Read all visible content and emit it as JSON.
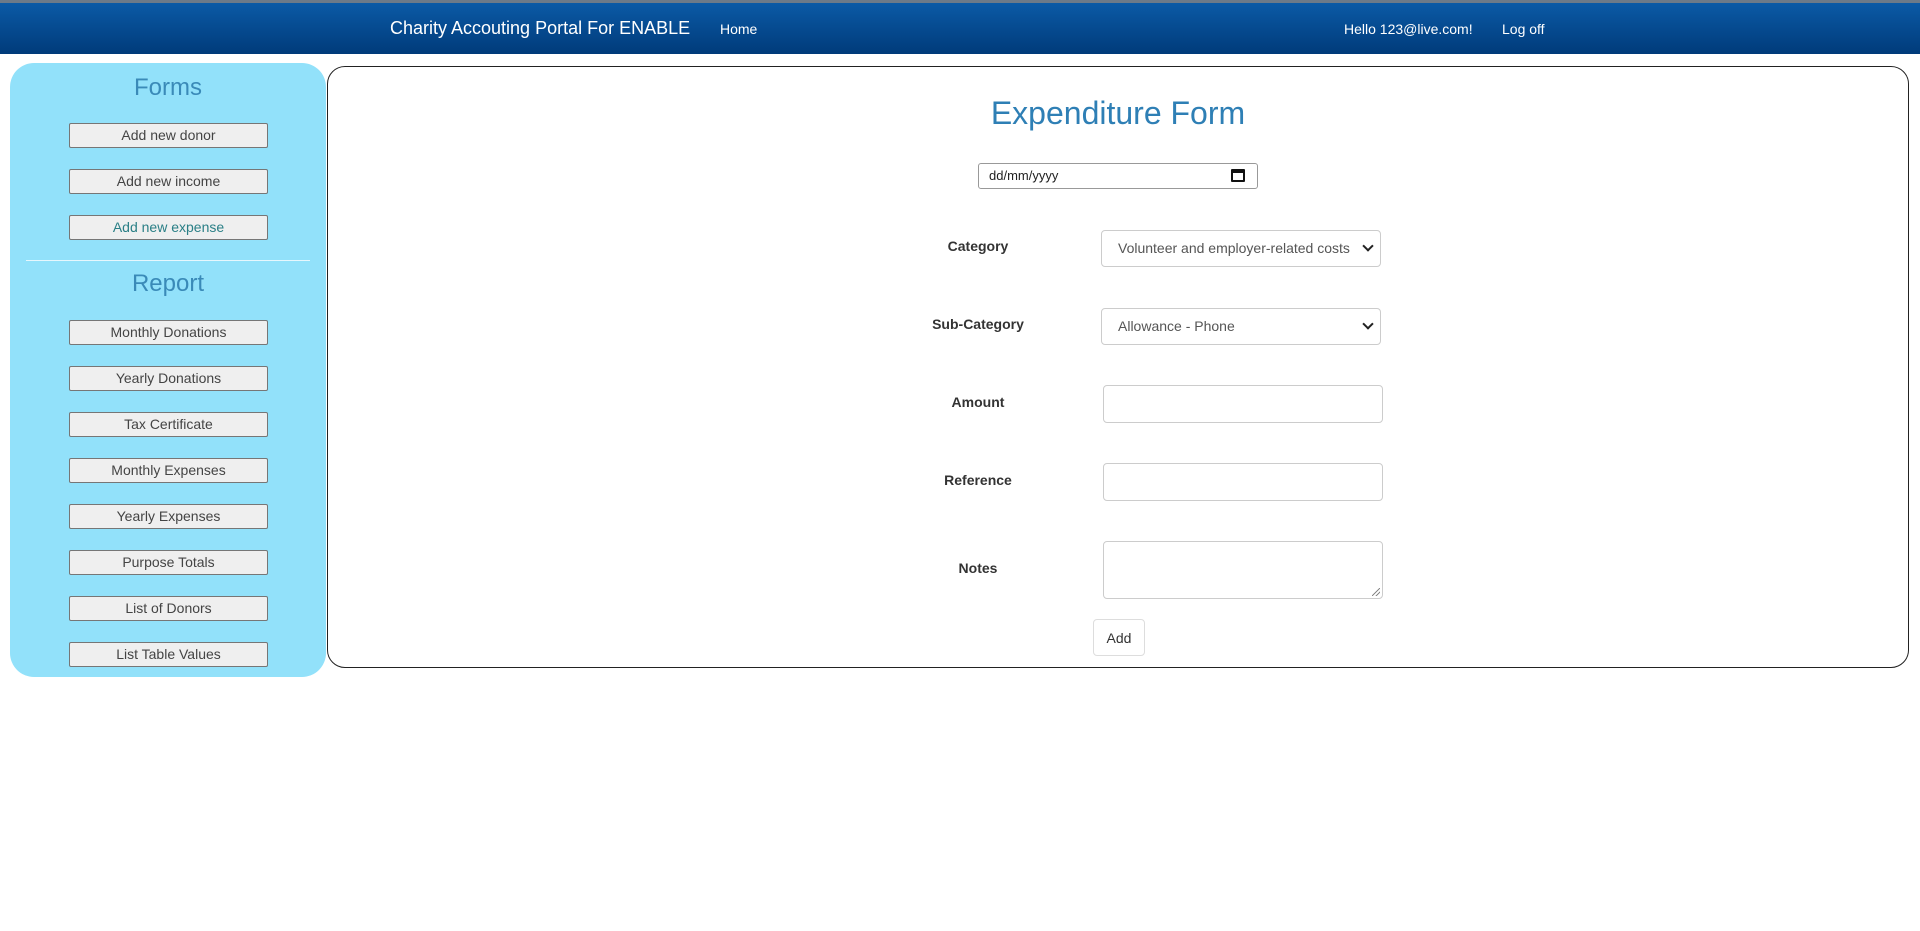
{
  "navbar": {
    "brand": "Charity Accouting Portal For ENABLE",
    "home": "Home",
    "greeting": "Hello 123@live.com!",
    "logoff": "Log off"
  },
  "sidebar": {
    "forms_heading": "Forms",
    "forms": [
      {
        "label": "Add new donor"
      },
      {
        "label": "Add new income"
      },
      {
        "label": "Add new expense"
      }
    ],
    "report_heading": "Report",
    "reports": [
      {
        "label": "Monthly Donations"
      },
      {
        "label": "Yearly Donations"
      },
      {
        "label": "Tax Certificate"
      },
      {
        "label": "Monthly Expenses"
      },
      {
        "label": "Yearly Expenses"
      },
      {
        "label": "Purpose Totals"
      },
      {
        "label": "List of Donors"
      },
      {
        "label": "List Table Values"
      }
    ]
  },
  "form": {
    "title": "Expenditure Form",
    "date_placeholder": "dd/mm/yyyy",
    "category_label": "Category",
    "category_value": "Volunteer and employer-related costs",
    "subcategory_label": "Sub-Category",
    "subcategory_value": "Allowance - Phone",
    "amount_label": "Amount",
    "amount_value": "",
    "reference_label": "Reference",
    "reference_value": "",
    "notes_label": "Notes",
    "notes_value": "",
    "submit_label": "Add"
  },
  "colors": {
    "navbar": "#004a94",
    "sidebar": "#92e1fa",
    "heading": "#2e7fb5"
  }
}
